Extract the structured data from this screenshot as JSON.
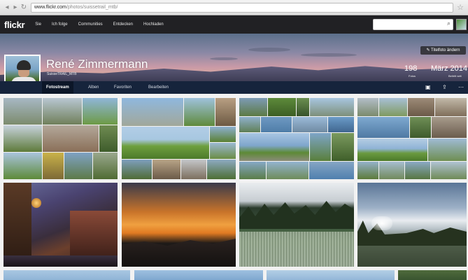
{
  "browser": {
    "url_host": "www.flickr.com",
    "url_path": "/photos/suissetrail_mtb/"
  },
  "topnav": {
    "logo": "flickr",
    "items": [
      "Sie",
      "Ich folge",
      "Communities",
      "Entdecken",
      "Hochladen"
    ]
  },
  "profile": {
    "name": "René Zimmermann",
    "subtitle": "SuisseTRAIL_MTB",
    "cover_button": "Titelfoto ändern",
    "stats": [
      {
        "value": "198",
        "label": "Fotos"
      },
      {
        "value": "März 2014",
        "label": "Beitritt seit"
      }
    ]
  },
  "subnav": {
    "tabs": [
      "Fotostream",
      "Alben",
      "Favoriten",
      "Bearbeiten"
    ],
    "active_tab": "Fotostream"
  },
  "icons": {
    "slideshow": "slideshow-icon",
    "share": "share-icon",
    "more": "more-icon",
    "search": "search-icon",
    "star": "star-icon"
  },
  "colors": {
    "topnav_bg": "#212124",
    "subnav_bg": "#16243c",
    "active_tab_bg": "#0c1628"
  }
}
